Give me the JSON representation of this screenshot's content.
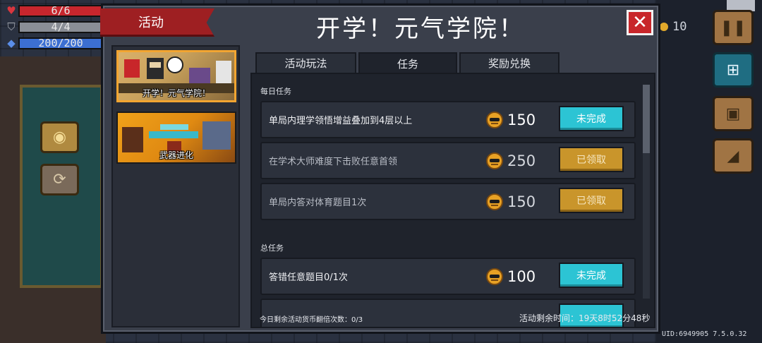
{
  "hud": {
    "hp": "6/6",
    "armor": "4/4",
    "energy": "200/200",
    "colors": {
      "hp": "#c7262d",
      "armor": "#8a8e96",
      "energy": "#3c6fd2"
    }
  },
  "coins": "10",
  "modal": {
    "ribbon": "活动",
    "title": "开学！元气学院！",
    "close_symbol": "✕"
  },
  "activities": [
    {
      "label": "开学！元气学院！",
      "selected": true
    },
    {
      "label": "武器进化",
      "selected": false
    }
  ],
  "tabs": [
    {
      "label": "活动玩法"
    },
    {
      "label": "任务",
      "active": true
    },
    {
      "label": "奖励兑换"
    }
  ],
  "sections": {
    "daily": "每日任务",
    "total": "总任务"
  },
  "daily_tasks": [
    {
      "desc": "单局内理学领悟增益叠加到4层以上",
      "reward": "150",
      "status": "未完成"
    },
    {
      "desc": "在学术大师难度下击败任意首领",
      "reward": "250",
      "status": "已领取"
    },
    {
      "desc": "单局内答对体育题目1次",
      "reward": "150",
      "status": "已领取"
    }
  ],
  "total_tasks": [
    {
      "desc": "答错任意题目0/1次",
      "reward": "100",
      "status": "未完成"
    }
  ],
  "footer": {
    "left": "今日剩余活动货币翻倍次数：0/3",
    "right": "活动剩余时间：19天8时52分48秒"
  },
  "uid": "UID:6949905 7.5.0.32",
  "accent_colors": {
    "incomplete_button": "#2cc4d4",
    "claimed_button": "#c9952b",
    "ribbon": "#9e1f22",
    "close_button": "#c8262a",
    "selected_card_border": "#f2a531"
  }
}
